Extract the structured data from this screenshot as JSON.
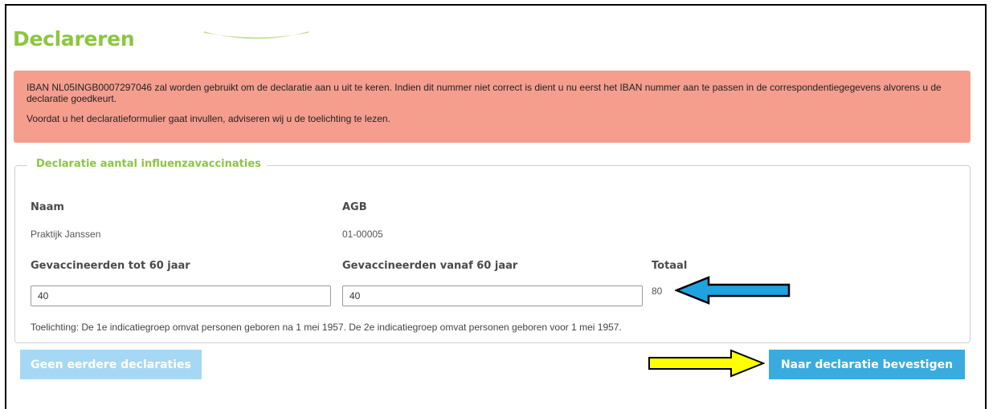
{
  "page": {
    "title": "Declareren"
  },
  "alert": {
    "line1": "IBAN NL05INGB0007297046 zal worden gebruikt om de declaratie aan u uit te keren. Indien dit nummer niet correct is dient u nu eerst het IBAN nummer aan te passen in de correspondentiegegevens alvorens u de declaratie goedkeurt.",
    "line2": "Voordat u het declaratieformulier gaat invullen, adviseren wij u de toelichting te lezen."
  },
  "form": {
    "legend": "Declaratie aantal influenzavaccinaties",
    "naam_label": "Naam",
    "naam_value": "Praktijk Janssen",
    "agb_label": "AGB",
    "agb_value": "01-00005",
    "under60_label": "Gevaccineerden tot 60 jaar",
    "under60_value": "40",
    "over60_label": "Gevaccineerden vanaf 60 jaar",
    "over60_value": "40",
    "total_label": "Totaal",
    "total_value": "80",
    "note": "Toelichting: De 1e indicatiegroep omvat personen geboren na 1 mei 1957. De 2e indicatiegroep omvat personen geboren voor 1 mei 1957."
  },
  "buttons": {
    "previous": "Geen eerdere declaraties",
    "next": "Naar declaratie bevestigen"
  },
  "colors": {
    "brand_green": "#8cc63f",
    "alert_bg": "#f59e8e",
    "button_primary": "#3aabdf",
    "button_disabled": "#a6d8f5",
    "annotation_blue": "#1fa3e0",
    "annotation_yellow": "#ffff00"
  }
}
